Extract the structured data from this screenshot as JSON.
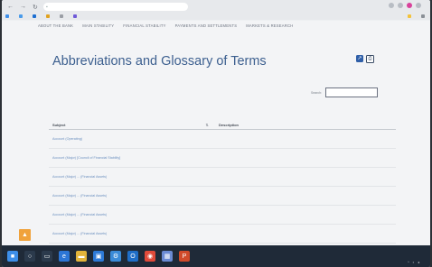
{
  "browser": {
    "url": "",
    "bookmarks": [
      {
        "label": "",
        "color": "#3d8ee8"
      },
      {
        "label": "",
        "color": "#4a9bea"
      },
      {
        "label": "",
        "color": "#1d6fd1"
      },
      {
        "label": "",
        "color": "#e0a21f"
      },
      {
        "label": "",
        "color": "#9a9ea5"
      },
      {
        "label": "",
        "color": "#6f5ad8"
      }
    ],
    "bookmarks_right": [
      {
        "label": "",
        "color": "#f3c23a"
      },
      {
        "label": "",
        "color": "#8a8f96"
      }
    ]
  },
  "nav": {
    "items": [
      {
        "label": "ABOUT THE BANK"
      },
      {
        "label": "MAIN STABILITY"
      },
      {
        "label": "FINANCIAL STABILITY"
      },
      {
        "label": "PAYMENTS AND SETTLEMENTS"
      },
      {
        "label": "MARKETS & RESEARCH"
      }
    ]
  },
  "page": {
    "title": "Abbreviations and Glossary of Terms",
    "search_label": "Search:",
    "search_value": ""
  },
  "table": {
    "headers": {
      "subject": "Subject",
      "description": "Description"
    },
    "rows": [
      {
        "subject": "Account (Operating)",
        "description": ""
      },
      {
        "subject": "Account (Major) [Council of Financial Stability]",
        "description": ""
      },
      {
        "subject": "Account (Major) ... (Financial Assets)",
        "description": ""
      },
      {
        "subject": "Account (Major) ... (Financial Assets)",
        "description": ""
      },
      {
        "subject": "Account (Major) ... (Financial Assets)",
        "description": ""
      },
      {
        "subject": "Account (Major) ... (Financial Assets)",
        "description": ""
      }
    ]
  },
  "taskbar": {
    "icons": [
      {
        "name": "start-icon",
        "glyph": "■",
        "color": "#3d8ee8"
      },
      {
        "name": "search-icon",
        "glyph": "○",
        "color": "#2b3a4c"
      },
      {
        "name": "task-view-icon",
        "glyph": "▭",
        "color": "#2b3a4c"
      },
      {
        "name": "edge-icon",
        "glyph": "e",
        "color": "#2c76d6"
      },
      {
        "name": "file-explorer-icon",
        "glyph": "▬",
        "color": "#e2b43a"
      },
      {
        "name": "store-icon",
        "glyph": "▣",
        "color": "#2d7ad8"
      },
      {
        "name": "settings-icon",
        "glyph": "⚙",
        "color": "#3b8bd8"
      },
      {
        "name": "outlook-icon",
        "glyph": "O",
        "color": "#1f6ec8"
      },
      {
        "name": "chrome-icon",
        "glyph": "◉",
        "color": "#e04a3a"
      },
      {
        "name": "photos-icon",
        "glyph": "▦",
        "color": "#6b8bd4"
      },
      {
        "name": "powerpoint-icon",
        "glyph": "P",
        "color": "#d04a2a"
      }
    ],
    "time": "",
    "date": ""
  }
}
